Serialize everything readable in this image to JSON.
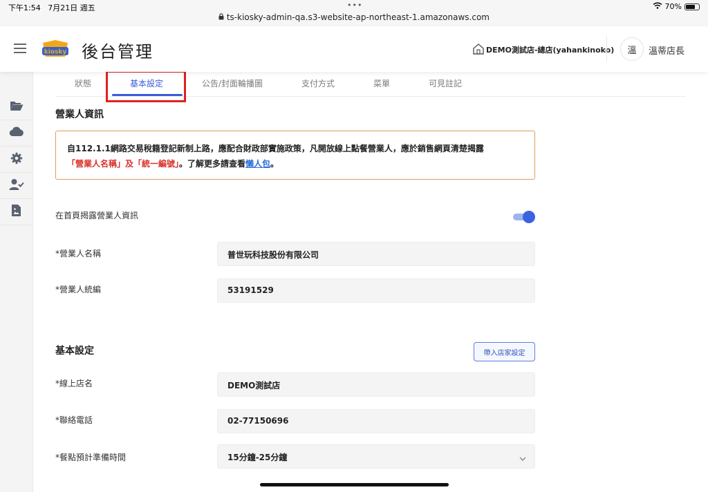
{
  "status_bar": {
    "time": "下午1:54",
    "date": "7月21日 週五",
    "dots": "•••",
    "url": "ts-kiosky-admin-qa.s3-website-ap-northeast-1.amazonaws.com",
    "battery": "70%",
    "battery_level": 0.7
  },
  "header": {
    "menu_icon": "menu-icon",
    "logo_icon": "kiosky-logo",
    "title": "後台管理",
    "store": "DEMO測試店-總店(yahankinoko)",
    "avatar_text": "溫",
    "user_name": "溫蒂店長"
  },
  "sidebar": {
    "items": [
      {
        "icon": "folder-open-icon"
      },
      {
        "icon": "cloud-icon"
      },
      {
        "icon": "gear-icon"
      },
      {
        "icon": "user-check-icon"
      },
      {
        "icon": "file-image-icon"
      }
    ]
  },
  "tabs": [
    {
      "label": "狀態"
    },
    {
      "label": "基本設定"
    },
    {
      "label": "公告/封面輪播圖"
    },
    {
      "label": "支付方式"
    },
    {
      "label": "菜單"
    },
    {
      "label": "可見註記"
    }
  ],
  "active_tab": "基本設定",
  "business_section": {
    "title": "營業人資訊",
    "notice": {
      "line1": "自112.1.1網路交易稅籍登記新制上路，應配合財政部實施政策，凡開放線上點餐營業人，應於銷售網頁清楚揭露",
      "highlight": "「營業人名稱」及「統一編號」",
      "line2_after": "。了解更多請查看",
      "link": "懶人包",
      "line2_end": "。"
    },
    "toggle_label": "在首頁揭露營業人資訊",
    "toggle_on": true,
    "name_label": "*營業人名稱",
    "name_value": "普世玩科技股份有限公司",
    "tax_label": "*營業人統編",
    "tax_value": "53191529"
  },
  "basic_section": {
    "title": "基本設定",
    "import_button": "帶入店家設定",
    "store_name_label": "*線上店名",
    "store_name_value": "DEMO測試店",
    "phone_label": "*聯絡電話",
    "phone_value": "02-77150696",
    "prep_label": "*餐點預計準備時間",
    "prep_value": "15分鐘-25分鐘"
  },
  "colors": {
    "accent": "#3b5bd9",
    "warning_border": "#e29a5a",
    "notice_red": "#d8322a",
    "link": "#2a6ed8",
    "highlight_box": "#e02020"
  }
}
